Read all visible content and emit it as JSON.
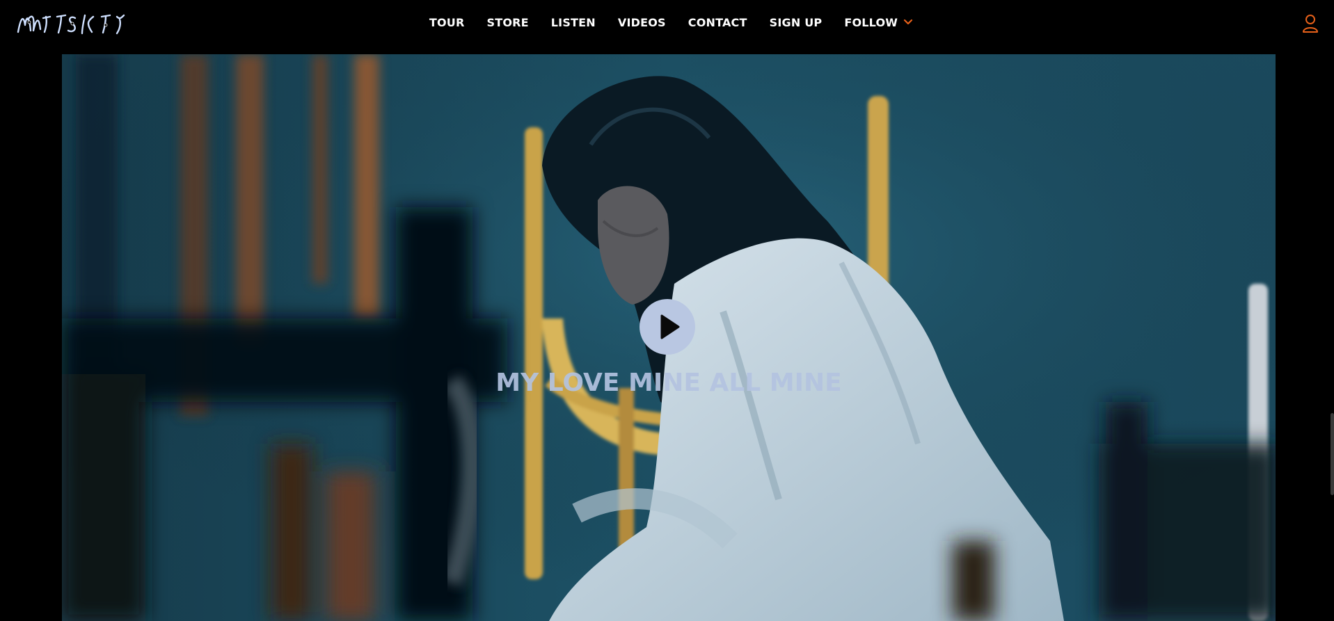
{
  "header": {
    "logo_text": "MITSKI",
    "nav": [
      "TOUR",
      "STORE",
      "LISTEN",
      "VIDEOS",
      "CONTACT",
      "SIGN UP"
    ],
    "follow_label": "FOLLOW"
  },
  "icons": {
    "follow_chevron": "chevron-down-icon",
    "account": "user-icon",
    "play": "play-icon"
  },
  "colors": {
    "accent": "#e8611a",
    "background": "#000000",
    "title_text": "#b4c3e0",
    "play_button": "#b9c7e2"
  },
  "hero": {
    "video_title": "MY LOVE MINE ALL MINE"
  }
}
